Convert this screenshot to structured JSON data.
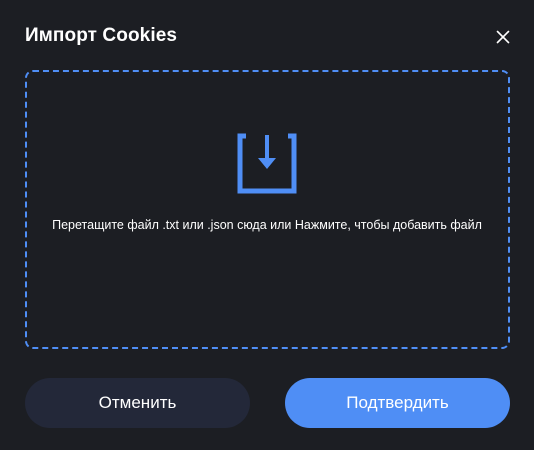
{
  "dialog": {
    "title": "Импорт Cookies",
    "close_icon": "close-icon"
  },
  "dropzone": {
    "icon": "upload-icon",
    "text": "Перетащите файл .txt или .json сюда или Нажмите, чтобы добавить файл"
  },
  "buttons": {
    "cancel_label": "Отменить",
    "confirm_label": "Подтвердить"
  },
  "colors": {
    "background": "#1c1e23",
    "accent": "#4f8ef5",
    "cancel_button": "#232839",
    "text": "#ffffff"
  }
}
